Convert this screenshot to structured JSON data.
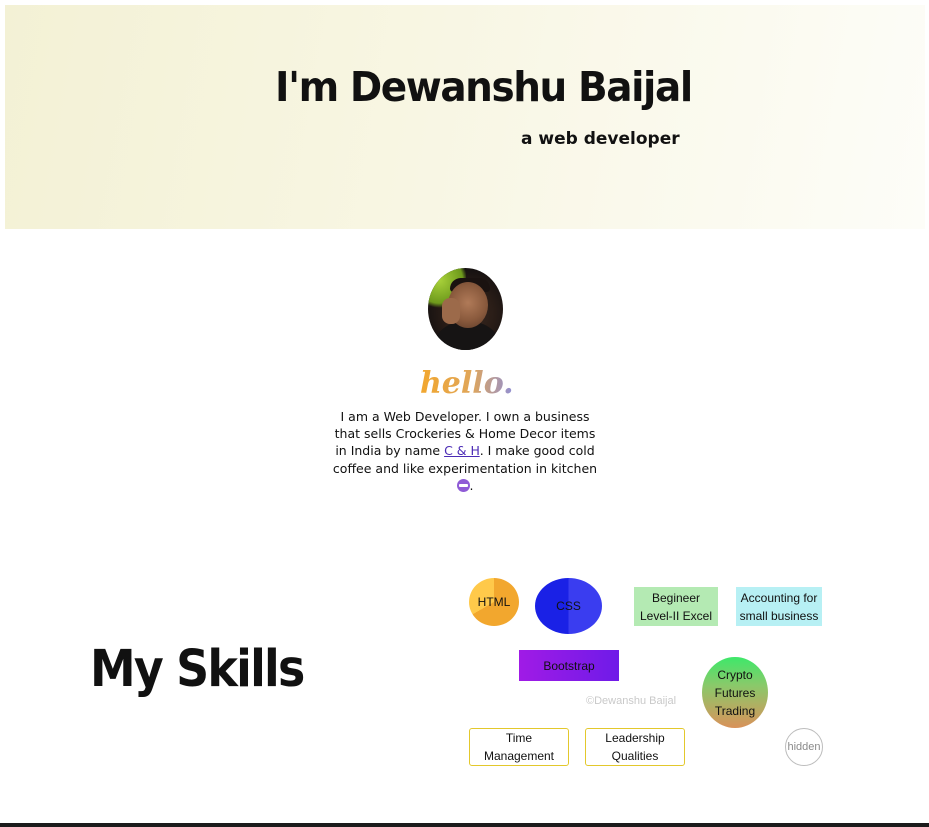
{
  "hero": {
    "title": "I'm Dewanshu Baijal",
    "subtitle": "a web developer"
  },
  "profile": {
    "avatar_icon": "profile-photo",
    "greeting": "hello.",
    "about_before_link": "I am a Web Developer. I own a business that sells Crockeries & Home Decor items in India by name ",
    "about_link": "C & H",
    "about_after_link": ". I make good cold coffee and like experimentation in kitchen",
    "about_end": ".",
    "emoji_icon": "ninja-emoji-icon"
  },
  "skills": {
    "title": "My Skills",
    "items": [
      {
        "label": "HTML"
      },
      {
        "label": "CSS"
      },
      {
        "label": "Begineer Level-II Excel"
      },
      {
        "label": "Accounting for small business"
      },
      {
        "label": "Bootstrap"
      },
      {
        "label": "Crypto Futures Trading"
      },
      {
        "label": "Time Management"
      },
      {
        "label": "Leadership Qualities"
      },
      {
        "label": "hidden"
      }
    ],
    "copyright": "©Dewanshu Baijal"
  },
  "colors": {
    "hero_bg": "#f3f1d5",
    "link": "#4b2bb5",
    "hello_start": "#f2a72e",
    "hello_end": "#8f8fd6"
  }
}
